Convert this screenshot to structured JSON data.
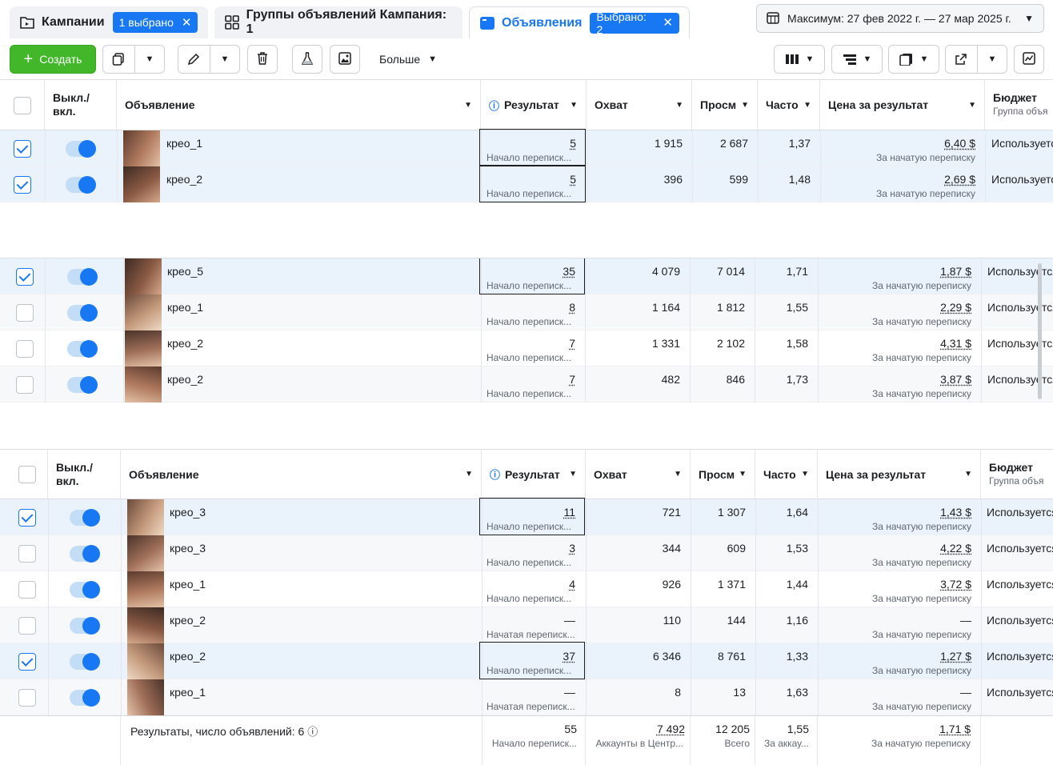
{
  "tabs": {
    "campaigns": {
      "label": "Кампании",
      "badge": "1 выбрано"
    },
    "adsets": {
      "label": "Группы объявлений Кампания: 1"
    },
    "ads": {
      "label": "Объявления",
      "badge": "Выбрано: 2"
    }
  },
  "date_range": "Максимум: 27 фев 2022 г. — 27 мар 2025 г.",
  "toolbar": {
    "create_label": "Создать",
    "more_label": "Больше"
  },
  "columns": {
    "onoff": "Выкл./ вкл.",
    "ad": "Объявление",
    "result": "Результат",
    "reach": "Охват",
    "impr": "Просм",
    "freq": "Часто",
    "cpr": "Цена за результат",
    "budget": "Бюджет",
    "budget_sub": "Группа объя"
  },
  "colors": {
    "accent": "#1877f2",
    "create_green": "#42b72a"
  },
  "table1": [
    {
      "name": "крео_1",
      "result": "5",
      "result_sub": "Начало переписк...",
      "reach": "1 915",
      "impr": "2 687",
      "freq": "1,37",
      "cpr": "6,40 $",
      "cpr_sub": "За начатую переписку",
      "budget": "Используется",
      "checked": true
    },
    {
      "name": "крео_2",
      "result": "5",
      "result_sub": "Начало переписк...",
      "reach": "396",
      "impr": "599",
      "freq": "1,48",
      "cpr": "2,69 $",
      "cpr_sub": "За начатую переписку",
      "budget": "Используется",
      "checked": true
    }
  ],
  "table2": [
    {
      "name": "крео_5",
      "result": "35",
      "result_sub": "Начало переписк...",
      "reach": "4 079",
      "impr": "7 014",
      "freq": "1,71",
      "cpr": "1,87 $",
      "cpr_sub": "За начатую переписку",
      "budget": "Используется",
      "checked": true
    },
    {
      "name": "крео_1",
      "result": "8",
      "result_sub": "Начало переписк...",
      "reach": "1 164",
      "impr": "1 812",
      "freq": "1,55",
      "cpr": "2,29 $",
      "cpr_sub": "За начатую переписку",
      "budget": "Используется",
      "checked": false
    },
    {
      "name": "крео_2",
      "result": "7",
      "result_sub": "Начало переписк...",
      "reach": "1 331",
      "impr": "2 102",
      "freq": "1,58",
      "cpr": "4,31 $",
      "cpr_sub": "За начатую переписку",
      "budget": "Используется",
      "checked": false
    },
    {
      "name": "крео_2",
      "result": "7",
      "result_sub": "Начало переписк...",
      "reach": "482",
      "impr": "846",
      "freq": "1,73",
      "cpr": "3,87 $",
      "cpr_sub": "За начатую переписку",
      "budget": "Используется",
      "checked": false
    }
  ],
  "table3": [
    {
      "name": "крео_3",
      "result": "11",
      "result_sub": "Начало переписк...",
      "reach": "721",
      "impr": "1 307",
      "freq": "1,64",
      "cpr": "1,43 $",
      "cpr_sub": "За начатую переписку",
      "budget": "Используется",
      "checked": true
    },
    {
      "name": "крео_3",
      "result": "3",
      "result_sub": "Начало переписк...",
      "reach": "344",
      "impr": "609",
      "freq": "1,53",
      "cpr": "4,22 $",
      "cpr_sub": "За начатую переписку",
      "budget": "Используется",
      "checked": false
    },
    {
      "name": "крео_1",
      "result": "4",
      "result_sub": "Начало переписк...",
      "reach": "926",
      "impr": "1 371",
      "freq": "1,44",
      "cpr": "3,72 $",
      "cpr_sub": "За начатую переписку",
      "budget": "Используется",
      "checked": false
    },
    {
      "name": "крео_2",
      "result": "—",
      "result_sub": "Начатая переписк...",
      "reach": "110",
      "impr": "144",
      "freq": "1,16",
      "cpr": "—",
      "cpr_sub": "За начатую переписку",
      "budget": "Используется",
      "checked": false
    },
    {
      "name": "крео_2",
      "result": "37",
      "result_sub": "Начало переписк...",
      "reach": "6 346",
      "impr": "8 761",
      "freq": "1,33",
      "cpr": "1,27 $",
      "cpr_sub": "За начатую переписку",
      "budget": "Используется",
      "checked": true
    },
    {
      "name": "крео_1",
      "result": "—",
      "result_sub": "Начатая переписк...",
      "reach": "8",
      "impr": "13",
      "freq": "1,63",
      "cpr": "—",
      "cpr_sub": "За начатую переписку",
      "budget": "Используется",
      "checked": false
    }
  ],
  "totals": {
    "label": "Результаты, число объявлений: 6",
    "result": "55",
    "result_sub": "Начало переписк...",
    "reach": "7 492",
    "reach_sub": "Аккаунты в Центр...",
    "impr": "12 205",
    "impr_sub": "Всего",
    "freq": "1,55",
    "freq_sub": "За аккау...",
    "cpr": "1,71 $",
    "cpr_sub": "За начатую переписку"
  }
}
